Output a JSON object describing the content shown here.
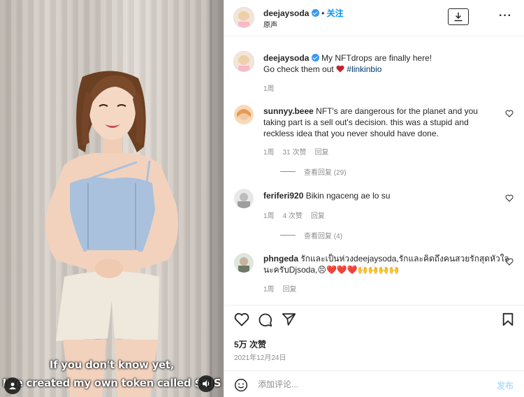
{
  "video": {
    "caption_line1": "If you don't know yet,",
    "caption_line2": "I've created my own token called $DJS",
    "profile_icon": "user-icon",
    "sound_icon": "speaker-icon"
  },
  "header": {
    "username": "deejaysoda",
    "follow_label": "关注",
    "audio_label": "原声",
    "separator": "•",
    "download_icon": "download-icon",
    "more_label": "···"
  },
  "post": {
    "username": "deejaysoda",
    "text_line1": "My NFTdrops are finally here!",
    "text_line2_pre": "Go check them out",
    "hashtag": "#linkinbio",
    "time": "1周"
  },
  "comments": [
    {
      "username": "sunnyy.beee",
      "line1": "NFT's are dangerous for the planet and you",
      "line2": "taking part is a sell out's decision. this was a stupid and",
      "line3": "reckless idea that you never should have done.",
      "time": "1周",
      "likes": "31 次赞",
      "reply": "回复",
      "view_replies": "查看回复 (29)"
    },
    {
      "username": "feriferi920",
      "line1": "Bikin ngaceng ae lo su",
      "time": "1周",
      "likes": "4 次赞",
      "reply": "回复",
      "view_replies": "查看回复 (4)"
    },
    {
      "username": "phngeda",
      "line1": "รักและเป็นห่วงdeejaysoda,รักและคิดถึงคนสวยรักสุดหัวใจ",
      "line2": "นะครับDjsoda,",
      "emojis": "😣❤️❤️❤️🙌🙌🙌🙌",
      "time": "1周",
      "reply": "回复"
    }
  ],
  "stats": {
    "likes": "5万 次赞",
    "date": "2021年12月24日"
  },
  "composer": {
    "placeholder": "添加评论...",
    "post_label": "发布"
  },
  "colors": {
    "accent": "#0095f6",
    "heart": "#ed4956",
    "muted": "#8e8e8e"
  }
}
